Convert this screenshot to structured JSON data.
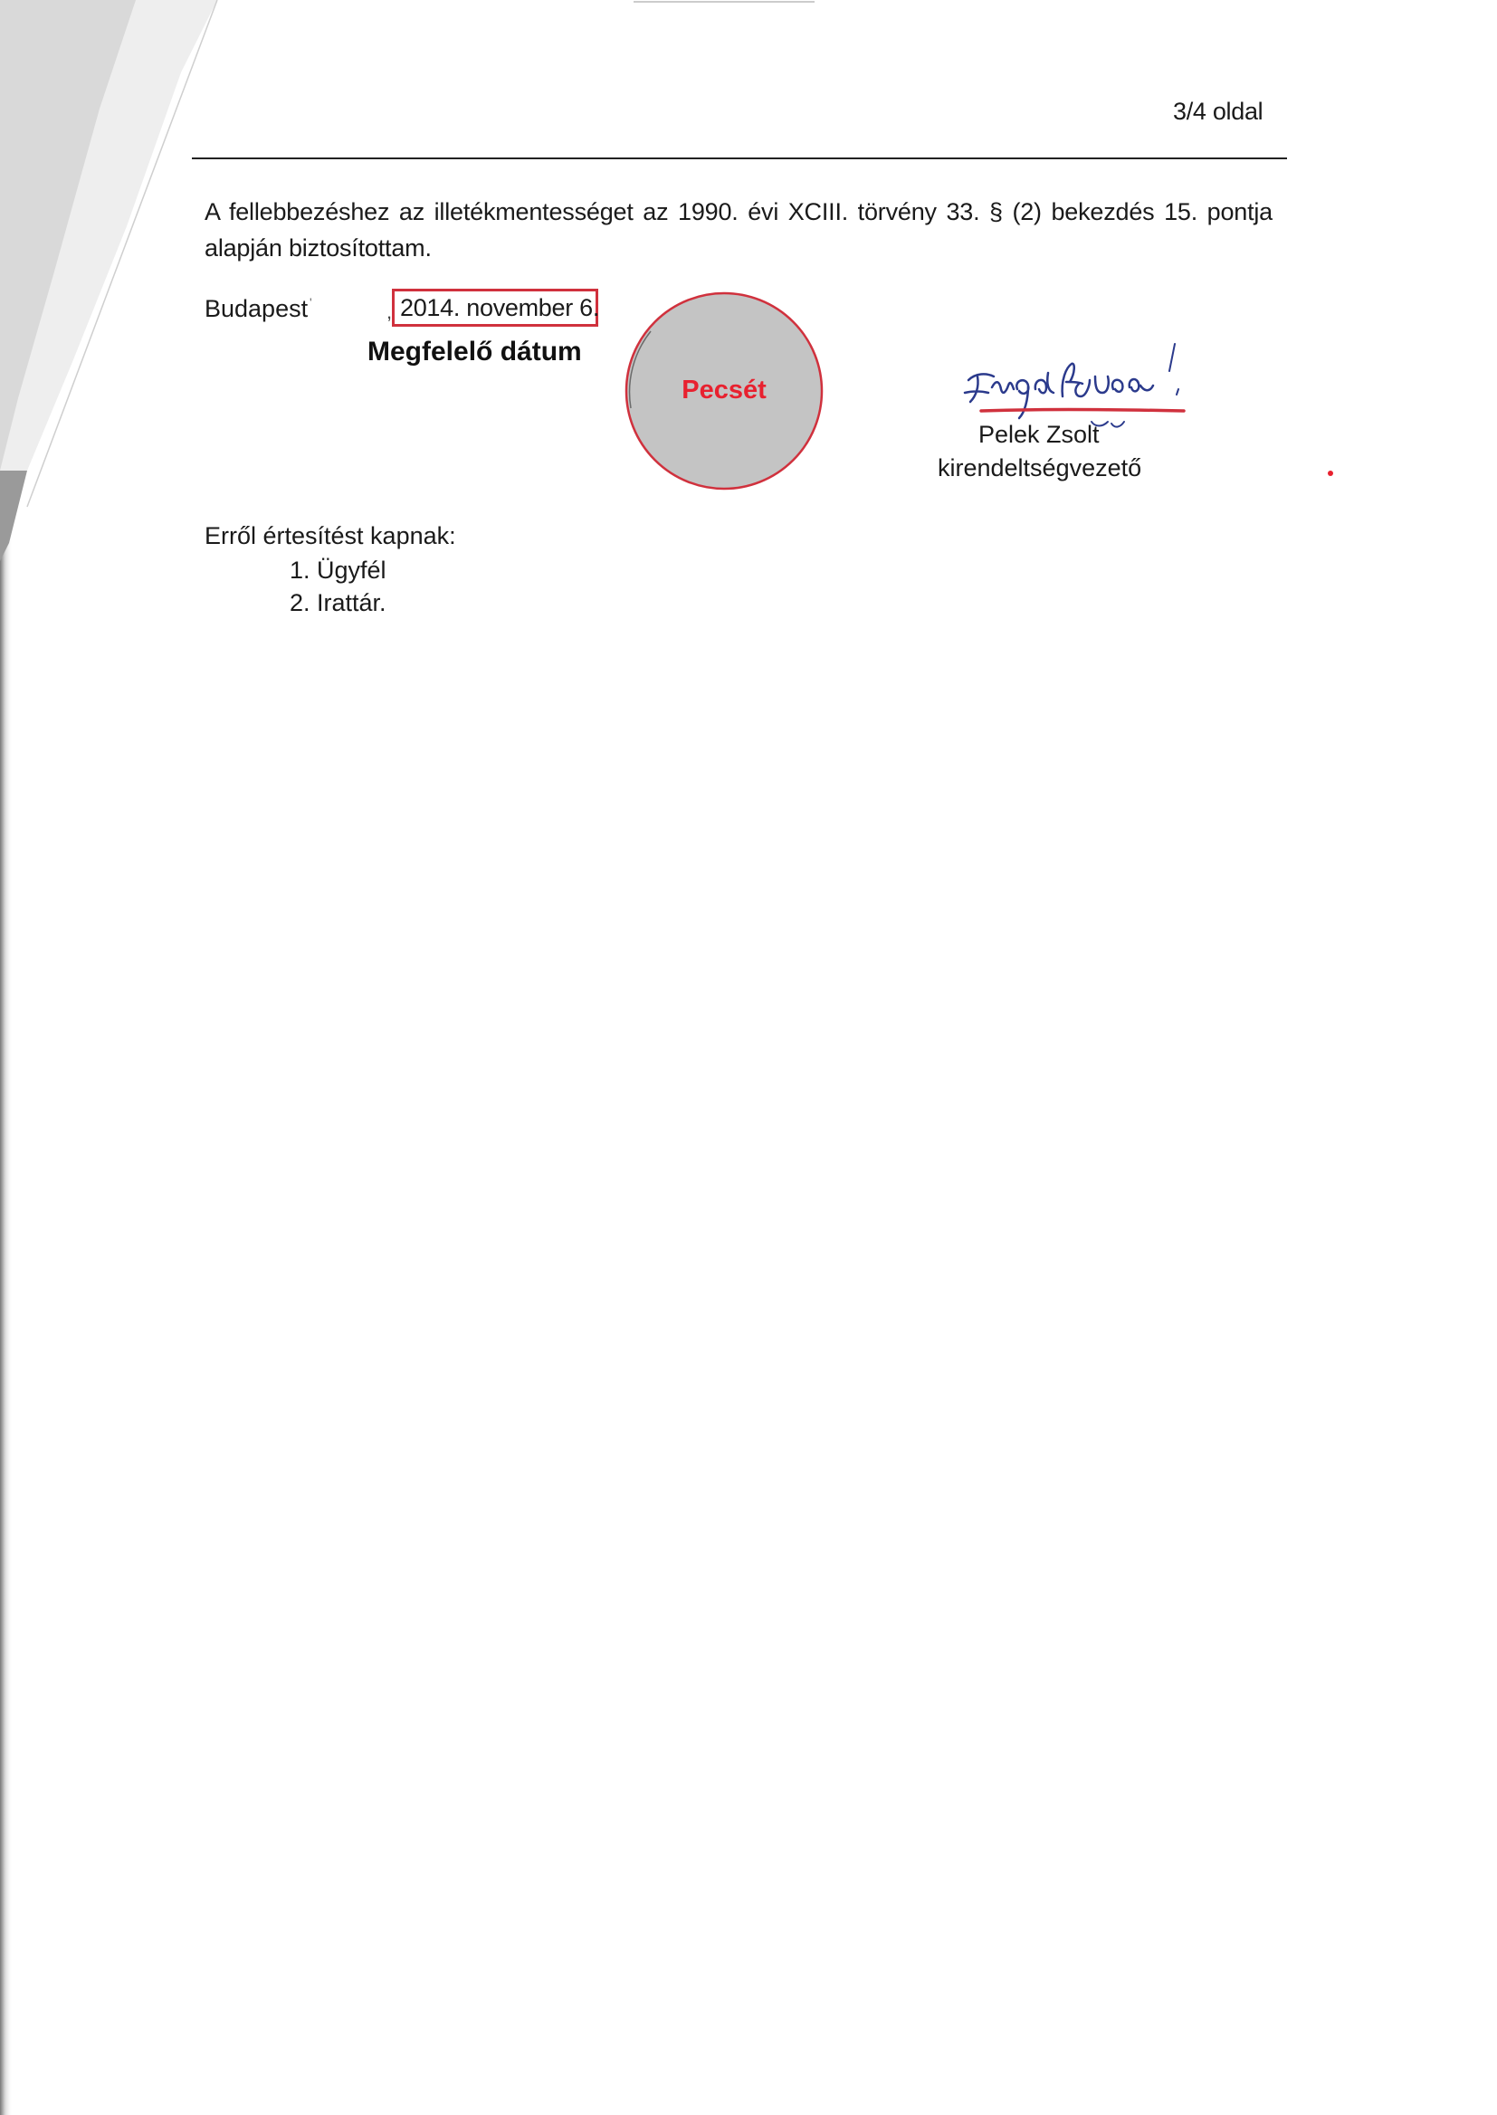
{
  "header": {
    "page_number": "3/4 oldal"
  },
  "body": {
    "paragraph": "A fellebbezéshez az illetékmentességet az 1990. évi XCIII. törvény 33. § (2) bekezdés 15. pontja alapján biztosítottam."
  },
  "date_line": {
    "city": "Budapest",
    "date": "2014. november 6.",
    "caption": "Megfelelő dátum"
  },
  "stamp": {
    "label": "Pecsét"
  },
  "signatory": {
    "name": "Pelek Zsolt",
    "title": "kirendeltségvezető"
  },
  "distribution": {
    "heading": "Erről értesítést kapnak:",
    "recipients": [
      "1. Ügyfél",
      "2. Irattár."
    ]
  },
  "colors": {
    "annotation_red": "#d0313d",
    "stamp_fill": "#c4c4c4",
    "ink_blue": "#2b3a8c"
  }
}
